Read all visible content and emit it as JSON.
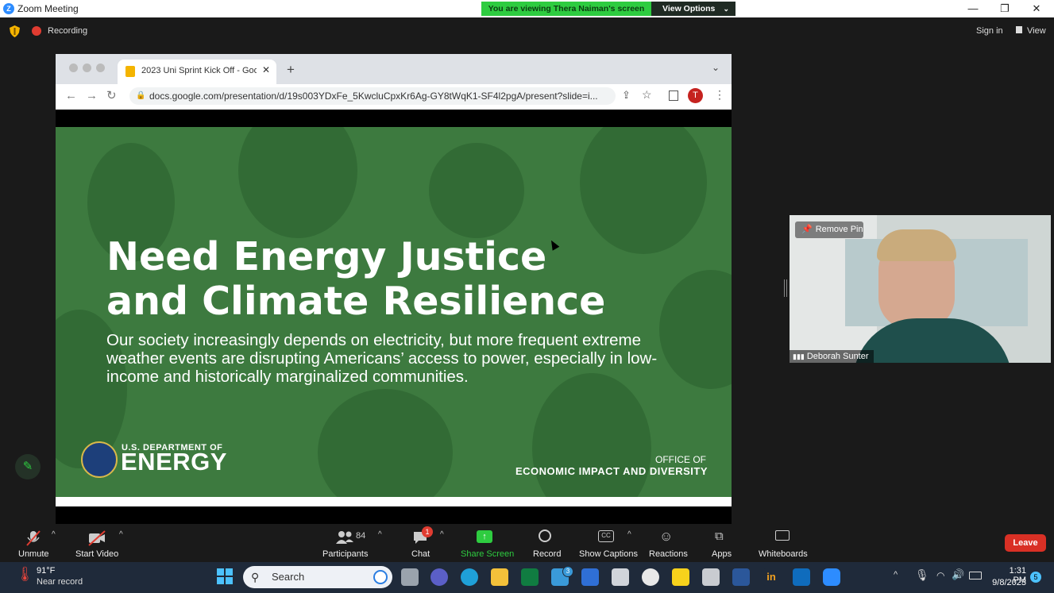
{
  "window": {
    "title": "Zoom Meeting",
    "controls": [
      "—",
      "❐",
      "✕"
    ]
  },
  "banner": {
    "viewing": "You are viewing Thera Naiman's screen",
    "view_options": "View Options"
  },
  "header": {
    "recording": "Recording",
    "sign_in": "Sign in",
    "view": "View"
  },
  "browser": {
    "tab_title": "2023 Uni Sprint Kick Off - Goo",
    "url": "docs.google.com/presentation/d/19s003YDxFe_5KwcluCpxKr6Ag-GY8tWqK1-SF4l2pgA/present?slide=i...",
    "profile_initial": "T"
  },
  "slide": {
    "headline_line1": "Need Energy Justice",
    "headline_line2": "and Climate Resilience",
    "body": "Our society increasingly depends on electricity, but more frequent extreme weather events are disrupting Americans’ access to power, especially in low-income and historically marginalized communities.",
    "logo_small": "U.S. DEPARTMENT OF",
    "logo_big": "ENERGY",
    "office_line1": "OFFICE OF",
    "office_line2": "ECONOMIC IMPACT AND DIVERSITY"
  },
  "video": {
    "remove_pin": "Remove Pin",
    "participant_name": "Deborah Sunter"
  },
  "toolbar": {
    "unmute": "Unmute",
    "start_video": "Start Video",
    "participants": "Participants",
    "participants_count": "84",
    "chat": "Chat",
    "chat_badge": "1",
    "share_screen": "Share Screen",
    "record": "Record",
    "show_captions": "Show Captions",
    "reactions": "Reactions",
    "apps": "Apps",
    "whiteboards": "Whiteboards",
    "leave": "Leave"
  },
  "taskbar": {
    "weather_temp": "91°F",
    "weather_desc": "Near record",
    "search_placeholder": "Search",
    "time": "1:31 PM",
    "date": "9/8/2023",
    "notification_count": "5",
    "mail_badge": "3"
  },
  "colors": {
    "slide_green": "#3d7a3f",
    "zoom_green": "#2ecc40",
    "leave_red": "#d93025",
    "accent_blue": "#2d8cff"
  }
}
